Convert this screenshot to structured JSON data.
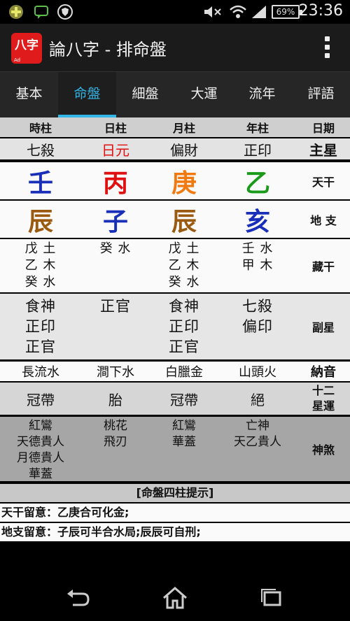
{
  "status_bar": {
    "battery": "69%",
    "time": "23:36"
  },
  "app": {
    "icon_text": "八字",
    "icon_sub": "Ad",
    "title": "論八字 - 排命盤"
  },
  "tabs": [
    "基本",
    "命盤",
    "細盤",
    "大運",
    "流年",
    "評語"
  ],
  "active_tab": "命盤",
  "header": [
    "時柱",
    "日柱",
    "月柱",
    "年柱",
    "日期"
  ],
  "main_star": {
    "values": [
      "七殺",
      "日元",
      "偏財",
      "正印"
    ],
    "label": "主星"
  },
  "heavenly_stem": {
    "values": [
      "壬",
      "丙",
      "庚",
      "乙"
    ],
    "label": "天干",
    "colors": [
      "#1a2fb8",
      "#e01010",
      "#f07a10",
      "#1a9a1a"
    ]
  },
  "earthly_branch": {
    "values": [
      "辰",
      "子",
      "辰",
      "亥"
    ],
    "label": "地 支",
    "colors": [
      "#9a5a10",
      "#1a2fb8",
      "#9a5a10",
      "#1a2fb8"
    ]
  },
  "hidden_stems": {
    "label": "藏干",
    "values": [
      [
        "戊 土",
        "乙 木",
        "癸 水"
      ],
      [
        "癸 水"
      ],
      [
        "戊 土",
        "乙 木",
        "癸 水"
      ],
      [
        "壬 水",
        "甲 木"
      ]
    ]
  },
  "sub_stars": {
    "label": "副星",
    "values": [
      [
        "食神",
        "正印",
        "正官"
      ],
      [
        "正官"
      ],
      [
        "食神",
        "正印",
        "正官"
      ],
      [
        "七殺",
        "偏印"
      ]
    ]
  },
  "nayin": {
    "label": "納音",
    "values": [
      "長流水",
      "澗下水",
      "白臘金",
      "山頭火"
    ]
  },
  "life_stage": {
    "label": "十二星運",
    "values": [
      "冠帶",
      "胎",
      "冠帶",
      "絕"
    ]
  },
  "shensha": {
    "label": "神煞",
    "values": [
      [
        "紅鸞",
        "天德貴人",
        "月德貴人",
        "華蓋"
      ],
      [
        "桃花",
        "飛刃"
      ],
      [
        "紅鸞",
        "華蓋"
      ],
      [
        "亡神",
        "天乙貴人"
      ]
    ]
  },
  "section_title": "[命盤四柱提示]",
  "notes": {
    "stem": "天干留意：乙庚合可化金;",
    "branch": "地支留意：子辰可半合水局;辰辰可自刑;"
  },
  "colors": {
    "accent": "#33b5e5",
    "day_master": "#e01010"
  }
}
